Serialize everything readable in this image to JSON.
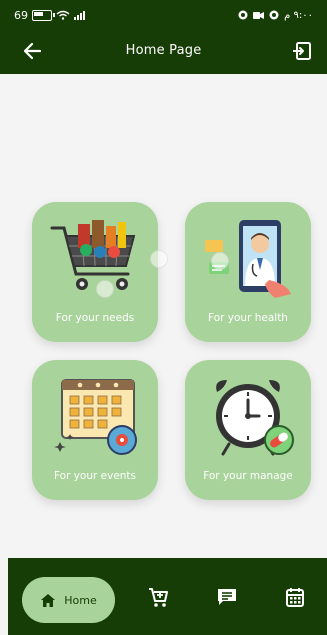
{
  "status_bar": {
    "left_text": "69",
    "right_text": "٩:٠٠ م"
  },
  "appbar": {
    "title": "Home Page"
  },
  "cards": [
    {
      "caption": "For your needs",
      "icon": "shopping-cart-icon"
    },
    {
      "caption": "For your health",
      "icon": "doctor-phone-icon"
    },
    {
      "caption": "For your events",
      "icon": "calendar-events-icon"
    },
    {
      "caption": "For your manage",
      "icon": "alarm-clock-pill-icon"
    }
  ],
  "bottom_nav": {
    "home_label": "Home",
    "items": [
      "cart-icon",
      "message-icon",
      "calendar-icon"
    ]
  },
  "colors": {
    "dark_green": "#173d07",
    "light_green": "#a8d39a",
    "background": "#f4f4f4"
  }
}
